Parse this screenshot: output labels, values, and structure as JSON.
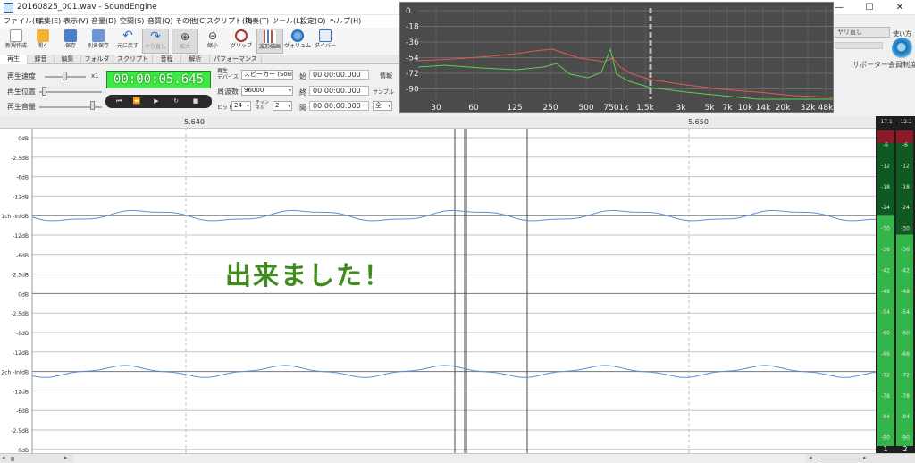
{
  "window": {
    "title": "20160825_001.wav - SoundEngine",
    "minimize": "—",
    "maximize": "☐",
    "close": "✕"
  },
  "menu": [
    "ファイル(F)",
    "編集(E)",
    "表示(V)",
    "音量(D)",
    "空間(S)",
    "音質(Q)",
    "その他(C)",
    "スクリプト(R)",
    "演奏(T)",
    "ツール(L)",
    "設定(O)",
    "ヘルプ(H)"
  ],
  "toolbar": [
    {
      "label": "新規作成",
      "icon": "new-file-icon",
      "color": "#ffffff"
    },
    {
      "label": "開く",
      "icon": "open-folder-icon",
      "color": "#f2b233"
    },
    {
      "label": "保存",
      "icon": "save-disk-icon",
      "color": "#4a7fd0"
    },
    {
      "label": "別名保存",
      "icon": "save-as-icon",
      "color": "#4a7fd0"
    },
    {
      "label": "元に戻す",
      "icon": "undo-icon",
      "color": "#2c6fd1"
    },
    {
      "label": "やり直し",
      "icon": "redo-icon",
      "color": "#2c6fd1"
    },
    {
      "label": "拡大",
      "icon": "zoom-in-icon",
      "color": "#555555"
    },
    {
      "label": "縮小",
      "icon": "zoom-out-icon",
      "color": "#555555"
    },
    {
      "label": "グリップ",
      "icon": "grip-icon",
      "color": "#b0302a"
    },
    {
      "label": "波形描画",
      "icon": "waveform-draw-icon",
      "color": "#c0504d"
    },
    {
      "label": "ヴォリュム",
      "icon": "volume-knob-icon",
      "color": "#1f6fbf"
    },
    {
      "label": "ダイバー",
      "icon": "diver-icon",
      "color": "#3b6ec9"
    }
  ],
  "tabs": [
    "再生",
    "録音",
    "編集",
    "フォルダ",
    "スクリプト",
    "音程",
    "解析",
    "パフォーマンス"
  ],
  "controls": {
    "speed_label": "再生速度",
    "speed_value": "x1",
    "position_label": "再生位置",
    "volume_label": "再生音量",
    "time": "00:00:05.645",
    "device_label": "再生\nデバイス",
    "device_value": "スピーカー (Soun",
    "rate_label": "周波数",
    "rate_value": "96000",
    "bits_label": "ビット",
    "bits_value": "24",
    "channels_label": "チャンネル",
    "channels_value": "2",
    "start_label": "始",
    "start_value": "00:00:00.000",
    "end_label": "終",
    "end_value": "00:00:00.000",
    "length_label": "間",
    "length_value": "00:00:00.000",
    "info_label": "情報",
    "sample_label": "サンプル",
    "all_value": "全"
  },
  "spectrum": {
    "db_labels": [
      "0",
      "-18",
      "-36",
      "-54",
      "-72",
      "-90"
    ],
    "freq_labels": [
      "30",
      "60",
      "125",
      "250",
      "500",
      "750",
      "1k",
      "1.5k",
      "3k",
      "5k",
      "7k",
      "10k",
      "14k",
      "20k",
      "32k",
      "48k"
    ]
  },
  "right_panel": {
    "snap_label": "ヤリ直し",
    "usage_label": "使い方",
    "support_label": "サポーター会員制度"
  },
  "ruler": {
    "marks": [
      "5.640",
      "5.650"
    ]
  },
  "wave": {
    "db_labels": [
      "0dB",
      "-2.5dB",
      "-6dB",
      "-12dB",
      "1ch -InfdB",
      "-12dB",
      "-6dB",
      "-2.5dB",
      "0dB",
      "-2.5dB",
      "-6dB",
      "-12dB",
      "2ch -InfdB",
      "-12dB",
      "-6dB",
      "-2.5dB",
      "0dB"
    ],
    "wave_color": "#5b8fd6"
  },
  "meter": {
    "peak_left": "-17.1",
    "peak_right": "-12.2",
    "scale": [
      "-6",
      "-12",
      "-18",
      "-24",
      "-30",
      "-36",
      "-42",
      "-48",
      "-54",
      "-60",
      "-66",
      "-72",
      "-78",
      "-84",
      "-90"
    ],
    "ch_left": "1",
    "ch_right": "2",
    "level_left": 0.73,
    "level_right": 0.67
  },
  "banner": "出来ました！"
}
